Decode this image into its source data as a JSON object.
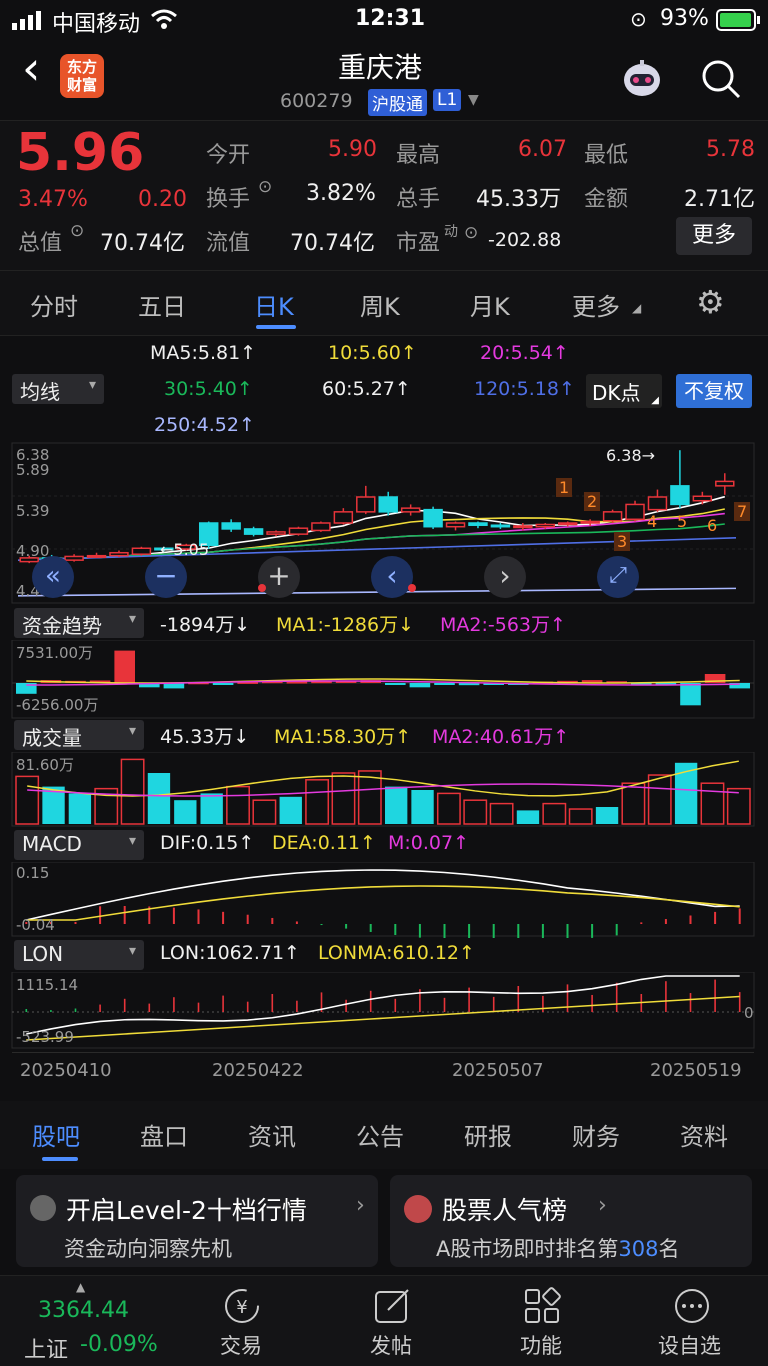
{
  "status_bar": {
    "carrier": "中国移动",
    "time": "12:31",
    "battery": "93%"
  },
  "header": {
    "back": "‹",
    "logo_line1": "东方",
    "logo_line2": "财富",
    "title": "重庆港",
    "code": "600279",
    "badge1": "沪股通",
    "badge2": "L1"
  },
  "quote": {
    "price": "5.96",
    "pct": "3.47%",
    "chg": "0.20",
    "rows": [
      [
        {
          "k": "今开",
          "v": "5.90",
          "c": "red"
        },
        {
          "k": "最高",
          "v": "6.07",
          "c": "red"
        },
        {
          "k": "最低",
          "v": "5.78",
          "c": "red"
        }
      ],
      [
        {
          "k": "换手",
          "v": "3.82%",
          "c": "white"
        },
        {
          "k": "总手",
          "v": "45.33万",
          "c": "white"
        },
        {
          "k": "金额",
          "v": "2.71亿",
          "c": "white"
        }
      ],
      [
        {
          "k": "总值",
          "v": "70.74亿",
          "c": "white"
        },
        {
          "k": "流值",
          "v": "70.74亿",
          "c": "white"
        },
        {
          "k": "市盈",
          "v": "-202.88",
          "c": "white"
        }
      ]
    ],
    "pe_sup": "动",
    "more": "更多"
  },
  "tabs": [
    "分时",
    "五日",
    "日K",
    "周K",
    "月K",
    "更多"
  ],
  "ma": {
    "select": "均线",
    "ma5": "MA5:5.81↑",
    "ma10": "10:5.60↑",
    "ma20": "20:5.54↑",
    "ma30": "30:5.40↑",
    "ma60": "60:5.27↑",
    "ma120": "120:5.18↑",
    "ma250": "250:4.52↑",
    "dk": "DK点",
    "fq": "不复权"
  },
  "kline": {
    "y_labels": [
      "6.38",
      "5.89",
      "5.39",
      "4.90",
      "4.40"
    ],
    "max_label": "6.38",
    "min_label": "5.05",
    "dk_points": [
      "1",
      "2",
      "3",
      "4",
      "5",
      "6",
      "7"
    ],
    "candles": [
      [
        4.88,
        4.93,
        4.86,
        4.96
      ],
      [
        4.93,
        4.9,
        4.86,
        4.97
      ],
      [
        4.9,
        4.95,
        4.88,
        4.98
      ],
      [
        4.95,
        4.96,
        4.93,
        5.0
      ],
      [
        4.96,
        5.0,
        4.94,
        5.03
      ],
      [
        4.98,
        5.06,
        4.96,
        5.08
      ],
      [
        5.06,
        5.05,
        5.02,
        5.08
      ],
      [
        5.05,
        5.1,
        5.03,
        5.12
      ],
      [
        5.4,
        5.1,
        5.05,
        5.42
      ],
      [
        5.4,
        5.32,
        5.28,
        5.45
      ],
      [
        5.32,
        5.25,
        5.22,
        5.35
      ],
      [
        5.25,
        5.28,
        5.22,
        5.3
      ],
      [
        5.25,
        5.33,
        5.23,
        5.35
      ],
      [
        5.3,
        5.4,
        5.28,
        5.42
      ],
      [
        5.4,
        5.55,
        5.38,
        5.6
      ],
      [
        5.55,
        5.75,
        5.52,
        5.9
      ],
      [
        5.75,
        5.55,
        5.5,
        5.82
      ],
      [
        5.55,
        5.6,
        5.5,
        5.65
      ],
      [
        5.58,
        5.35,
        5.32,
        5.62
      ],
      [
        5.35,
        5.4,
        5.3,
        5.42
      ],
      [
        5.4,
        5.37,
        5.33,
        5.42
      ],
      [
        5.37,
        5.35,
        5.32,
        5.4
      ],
      [
        5.35,
        5.36,
        5.3,
        5.4
      ],
      [
        5.35,
        5.38,
        5.32,
        5.4
      ],
      [
        5.38,
        5.4,
        5.35,
        5.42
      ],
      [
        5.4,
        5.42,
        5.36,
        5.45
      ],
      [
        5.43,
        5.55,
        5.4,
        5.58
      ],
      [
        5.45,
        5.65,
        5.42,
        5.7
      ],
      [
        5.58,
        5.75,
        5.55,
        5.85
      ],
      [
        5.9,
        5.65,
        5.6,
        6.38
      ],
      [
        5.7,
        5.76,
        5.65,
        5.82
      ],
      [
        5.9,
        5.96,
        5.78,
        6.07
      ]
    ]
  },
  "nav_buttons": [
    "«",
    "−",
    "+",
    "‹",
    "›",
    "⤢"
  ],
  "flow": {
    "select": "资金趋势",
    "v": "-1894万↓",
    "ma1": "MA1:-1286万↓",
    "ma2": "MA2:-563万↑",
    "top": "7531.00万",
    "bot": "-6256.00万",
    "bars": [
      -0.3,
      0.08,
      0.06,
      0.07,
      0.9,
      -0.12,
      -0.15,
      0.02,
      -0.03,
      0.03,
      0.05,
      0.04,
      0.05,
      0.06,
      0.08,
      -0.05,
      -0.12,
      -0.03,
      -0.06,
      -0.04,
      -0.05,
      0.04,
      0.06,
      0.08,
      0.05,
      -0.03,
      -0.05,
      -0.62,
      0.25,
      -0.15
    ]
  },
  "vol": {
    "select": "成交量",
    "v": "45.33万↓",
    "ma1": "MA1:58.30万↑",
    "ma2": "MA2:40.61万↑",
    "top": "81.60万",
    "bars": [
      [
        0.7,
        "r"
      ],
      [
        0.55,
        "g"
      ],
      [
        0.45,
        "g"
      ],
      [
        0.52,
        "r"
      ],
      [
        0.95,
        "r"
      ],
      [
        0.75,
        "g"
      ],
      [
        0.35,
        "g"
      ],
      [
        0.45,
        "g"
      ],
      [
        0.55,
        "r"
      ],
      [
        0.35,
        "r"
      ],
      [
        0.4,
        "g"
      ],
      [
        0.65,
        "r"
      ],
      [
        0.75,
        "r"
      ],
      [
        0.78,
        "r"
      ],
      [
        0.55,
        "g"
      ],
      [
        0.5,
        "g"
      ],
      [
        0.45,
        "r"
      ],
      [
        0.35,
        "r"
      ],
      [
        0.3,
        "r"
      ],
      [
        0.2,
        "g"
      ],
      [
        0.3,
        "r"
      ],
      [
        0.22,
        "r"
      ],
      [
        0.25,
        "g"
      ],
      [
        0.6,
        "r"
      ],
      [
        0.72,
        "r"
      ],
      [
        0.9,
        "g"
      ],
      [
        0.6,
        "r"
      ],
      [
        0.52,
        "r"
      ]
    ]
  },
  "macd": {
    "select": "MACD",
    "dif": "DIF:0.15↑",
    "dea": "DEA:0.11↑",
    "m": "M:0.07↑",
    "top": "0.15",
    "bot": "-0.04"
  },
  "lon": {
    "select": "LON",
    "lon": "LON:1062.71↑",
    "lonma": "LONMA:610.12↑",
    "top": "1115.14",
    "bot": "-523.99",
    "zero": "0"
  },
  "dates": [
    "20250410",
    "20250422",
    "20250507",
    "20250519"
  ],
  "bottom_tabs": [
    "股吧",
    "盘口",
    "资讯",
    "公告",
    "研报",
    "财务",
    "资料"
  ],
  "cards": [
    {
      "title": "开启Level-2十档行情",
      "sub": "资金动向洞察先机"
    },
    {
      "title": "股票人气榜",
      "sub_a": "A股市场即时排名第",
      "rank": "308",
      "sub_b": "名"
    }
  ],
  "footer": {
    "index_val": "3364.44",
    "index_name": "上证",
    "index_chg": "-0.09%",
    "items": [
      "交易",
      "发帖",
      "功能",
      "设自选"
    ]
  },
  "colors": {
    "up": "#e8343a",
    "down": "#1fd6e0",
    "accent": "#4d8dff"
  }
}
